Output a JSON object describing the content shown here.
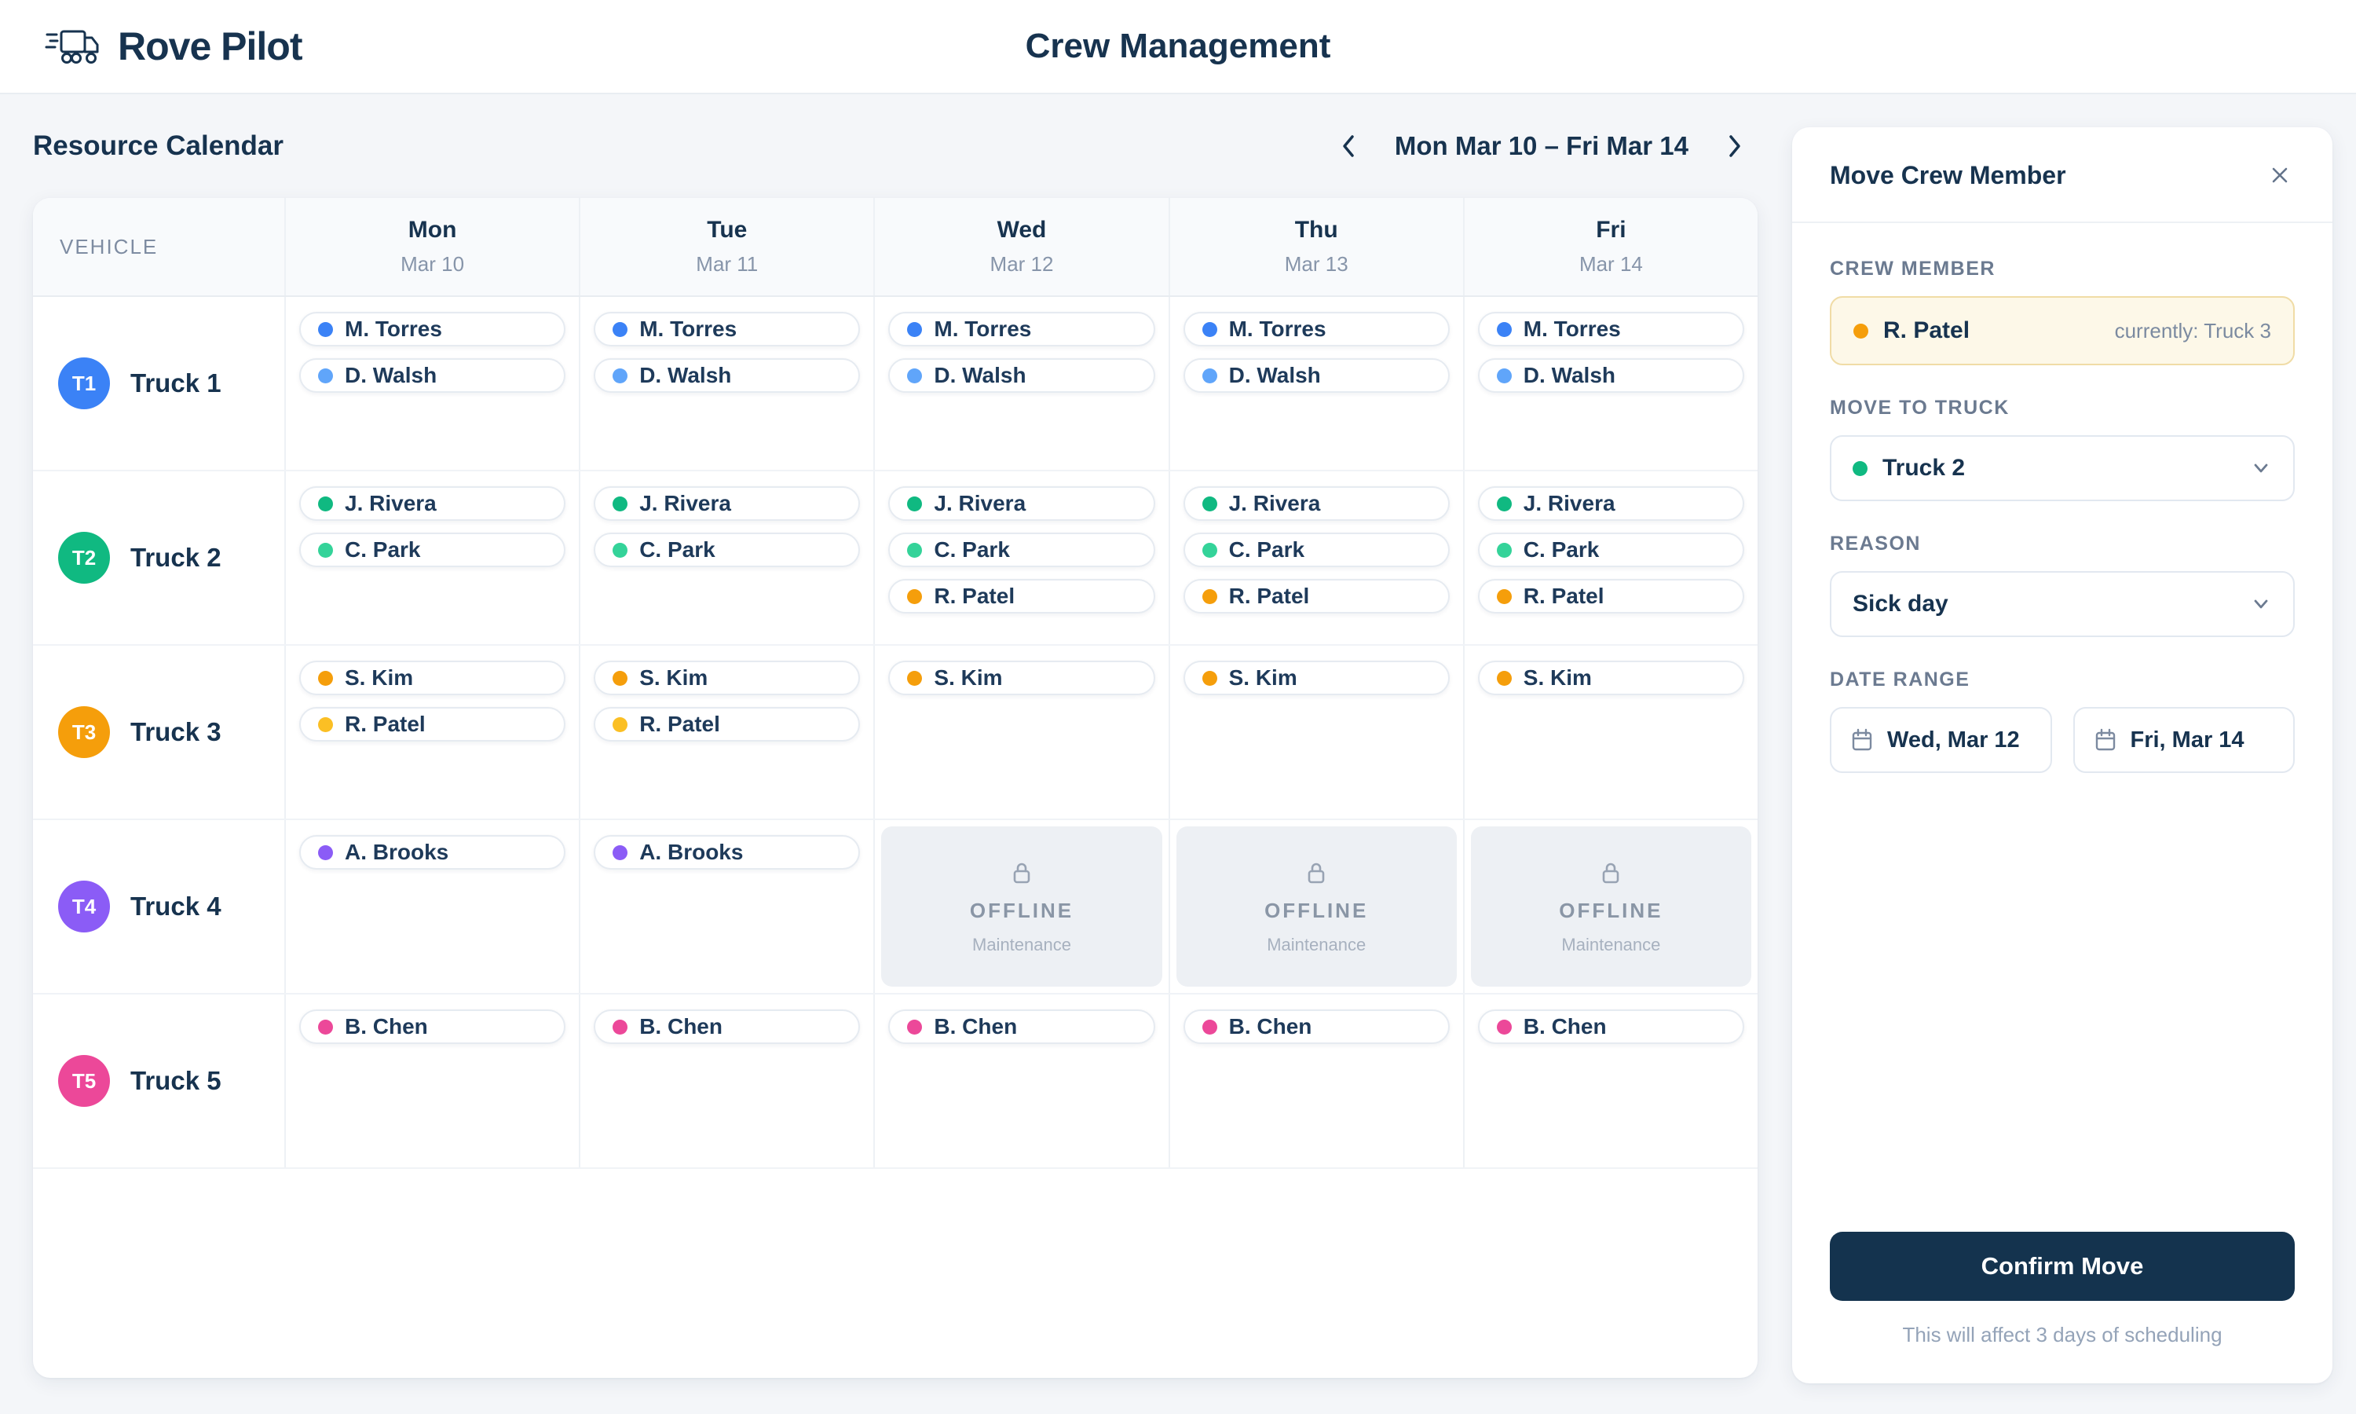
{
  "app": {
    "brand": "Rove Pilot",
    "page_title": "Crew Management"
  },
  "toolbar": {
    "heading": "Resource Calendar",
    "week_label": "Mon Mar 10 – Fri Mar 14"
  },
  "calendar": {
    "vehicle_header": "VEHICLE",
    "days": [
      {
        "name": "Mon",
        "date": "Mar 10"
      },
      {
        "name": "Tue",
        "date": "Mar 11"
      },
      {
        "name": "Wed",
        "date": "Mar 12"
      },
      {
        "name": "Thu",
        "date": "Mar 13"
      },
      {
        "name": "Fri",
        "date": "Mar 14"
      }
    ],
    "offline": {
      "label": "OFFLINE",
      "sublabel": "Maintenance"
    },
    "trucks": [
      {
        "id": "T1",
        "name": "Truck 1",
        "color": "#3b82f6",
        "cells": [
          {
            "type": "crew",
            "chips": [
              {
                "name": "M. Torres",
                "color": "#3b82f6"
              },
              {
                "name": "D. Walsh",
                "color": "#60a5fa"
              }
            ]
          },
          {
            "type": "crew",
            "chips": [
              {
                "name": "M. Torres",
                "color": "#3b82f6"
              },
              {
                "name": "D. Walsh",
                "color": "#60a5fa"
              }
            ]
          },
          {
            "type": "crew",
            "chips": [
              {
                "name": "M. Torres",
                "color": "#3b82f6"
              },
              {
                "name": "D. Walsh",
                "color": "#60a5fa"
              }
            ]
          },
          {
            "type": "crew",
            "chips": [
              {
                "name": "M. Torres",
                "color": "#3b82f6"
              },
              {
                "name": "D. Walsh",
                "color": "#60a5fa"
              }
            ]
          },
          {
            "type": "crew",
            "chips": [
              {
                "name": "M. Torres",
                "color": "#3b82f6"
              },
              {
                "name": "D. Walsh",
                "color": "#60a5fa"
              }
            ]
          }
        ]
      },
      {
        "id": "T2",
        "name": "Truck 2",
        "color": "#10b981",
        "cells": [
          {
            "type": "crew",
            "chips": [
              {
                "name": "J. Rivera",
                "color": "#10b981"
              },
              {
                "name": "C. Park",
                "color": "#34d399"
              }
            ]
          },
          {
            "type": "crew",
            "chips": [
              {
                "name": "J. Rivera",
                "color": "#10b981"
              },
              {
                "name": "C. Park",
                "color": "#34d399"
              }
            ]
          },
          {
            "type": "crew",
            "chips": [
              {
                "name": "J. Rivera",
                "color": "#10b981"
              },
              {
                "name": "C. Park",
                "color": "#34d399"
              },
              {
                "name": "R. Patel",
                "color": "#f59e0b"
              }
            ]
          },
          {
            "type": "crew",
            "chips": [
              {
                "name": "J. Rivera",
                "color": "#10b981"
              },
              {
                "name": "C. Park",
                "color": "#34d399"
              },
              {
                "name": "R. Patel",
                "color": "#f59e0b"
              }
            ]
          },
          {
            "type": "crew",
            "chips": [
              {
                "name": "J. Rivera",
                "color": "#10b981"
              },
              {
                "name": "C. Park",
                "color": "#34d399"
              },
              {
                "name": "R. Patel",
                "color": "#f59e0b"
              }
            ]
          }
        ]
      },
      {
        "id": "T3",
        "name": "Truck 3",
        "color": "#f59e0b",
        "cells": [
          {
            "type": "crew",
            "chips": [
              {
                "name": "S. Kim",
                "color": "#f59e0b"
              },
              {
                "name": "R. Patel",
                "color": "#fbbf24"
              }
            ]
          },
          {
            "type": "crew",
            "chips": [
              {
                "name": "S. Kim",
                "color": "#f59e0b"
              },
              {
                "name": "R. Patel",
                "color": "#fbbf24"
              }
            ]
          },
          {
            "type": "crew",
            "chips": [
              {
                "name": "S. Kim",
                "color": "#f59e0b"
              }
            ]
          },
          {
            "type": "crew",
            "chips": [
              {
                "name": "S. Kim",
                "color": "#f59e0b"
              }
            ]
          },
          {
            "type": "crew",
            "chips": [
              {
                "name": "S. Kim",
                "color": "#f59e0b"
              }
            ]
          }
        ]
      },
      {
        "id": "T4",
        "name": "Truck 4",
        "color": "#8b5cf6",
        "cells": [
          {
            "type": "crew",
            "chips": [
              {
                "name": "A. Brooks",
                "color": "#8b5cf6"
              }
            ]
          },
          {
            "type": "crew",
            "chips": [
              {
                "name": "A. Brooks",
                "color": "#8b5cf6"
              }
            ]
          },
          {
            "type": "offline"
          },
          {
            "type": "offline"
          },
          {
            "type": "offline"
          }
        ]
      },
      {
        "id": "T5",
        "name": "Truck 5",
        "color": "#ec4899",
        "cells": [
          {
            "type": "crew",
            "chips": [
              {
                "name": "B. Chen",
                "color": "#ec4899"
              }
            ]
          },
          {
            "type": "crew",
            "chips": [
              {
                "name": "B. Chen",
                "color": "#ec4899"
              }
            ]
          },
          {
            "type": "crew",
            "chips": [
              {
                "name": "B. Chen",
                "color": "#ec4899"
              }
            ]
          },
          {
            "type": "crew",
            "chips": [
              {
                "name": "B. Chen",
                "color": "#ec4899"
              }
            ]
          },
          {
            "type": "crew",
            "chips": [
              {
                "name": "B. Chen",
                "color": "#ec4899"
              }
            ]
          }
        ]
      }
    ]
  },
  "panel": {
    "title": "Move Crew Member",
    "sections": {
      "crew_member": {
        "label": "CREW MEMBER",
        "name": "R. Patel",
        "dot_color": "#f59e0b",
        "current": "currently: Truck 3"
      },
      "move_to": {
        "label": "MOVE TO TRUCK",
        "value": "Truck 2",
        "dot_color": "#10b981"
      },
      "reason": {
        "label": "REASON",
        "value": "Sick day"
      },
      "date_range": {
        "label": "DATE RANGE",
        "start": "Wed, Mar 12",
        "end": "Fri, Mar 14"
      }
    },
    "confirm_label": "Confirm Move",
    "footnote": "This will affect 3 days of scheduling"
  },
  "colors": {
    "brand_navy": "#17334f",
    "confirm_button": "#14334e",
    "highlight_bg": "#fdf8e8",
    "highlight_border": "#f0dca6"
  }
}
